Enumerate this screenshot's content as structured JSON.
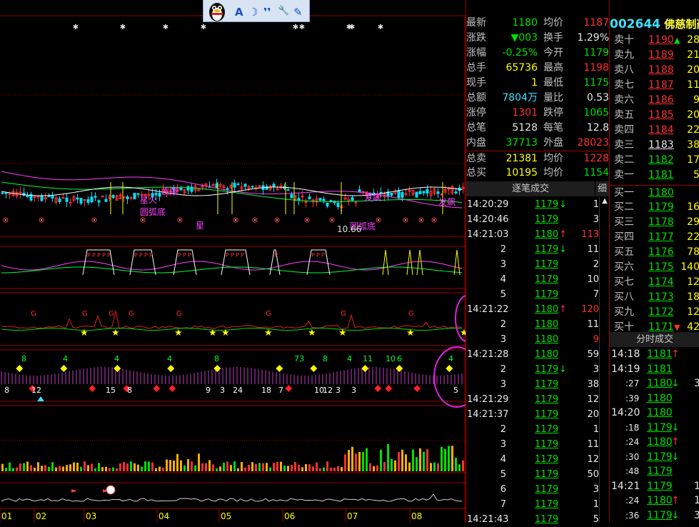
{
  "stock": {
    "code": "002644",
    "name": "佛慈制药"
  },
  "quote_rows": [
    {
      "l1": "最新",
      "v1": "1180",
      "c1": "green",
      "l2": "均价",
      "v2": "1187",
      "c2": "red"
    },
    {
      "l1": "涨跌",
      "v1": "▼003",
      "c1": "green",
      "l2": "换手",
      "v2": "1.29%",
      "c2": "white"
    },
    {
      "l1": "涨幅",
      "v1": "-0.25%",
      "c1": "green",
      "l2": "今开",
      "v2": "1179",
      "c2": "green"
    },
    {
      "l1": "总手",
      "v1": "65736",
      "c1": "yellow",
      "l2": "最高",
      "v2": "1198",
      "c2": "red"
    },
    {
      "l1": "现手",
      "v1": "1",
      "c1": "yellow",
      "l2": "最低",
      "v2": "1175",
      "c2": "green"
    },
    {
      "l1": "总额",
      "v1": "7804万",
      "c1": "cyan",
      "l2": "量比",
      "v2": "0.53",
      "c2": "white"
    },
    {
      "l1": "涨停",
      "v1": "1301",
      "c1": "red",
      "l2": "跌停",
      "v2": "1065",
      "c2": "green"
    },
    {
      "l1": "总笔",
      "v1": "5128",
      "c1": "white",
      "l2": "每笔",
      "v2": "12.8",
      "c2": "white"
    },
    {
      "l1": "内盘",
      "v1": "37713",
      "c1": "green",
      "l2": "外盘",
      "v2": "28023",
      "c2": "red"
    },
    {
      "l1": "总卖",
      "v1": "21381",
      "c1": "yellow",
      "l2": "均价",
      "v2": "1228",
      "c2": "red"
    },
    {
      "l1": "总买",
      "v1": "10195",
      "c1": "yellow",
      "l2": "均价",
      "v2": "1154",
      "c2": "green"
    }
  ],
  "tick_header": {
    "title": "逐笔成交",
    "detail": "细"
  },
  "ticks": [
    {
      "time": "14:20:29",
      "price": "1179",
      "arrow": "↓",
      "pc": "green",
      "vol": "1",
      "vc": "white"
    },
    {
      "time": "14:20:46",
      "price": "1179",
      "arrow": "",
      "pc": "green",
      "vol": "3",
      "vc": "white"
    },
    {
      "time": "14:21:03",
      "price": "1180",
      "arrow": "↑",
      "pc": "green",
      "vol": "113",
      "vc": "red"
    },
    {
      "time": "2",
      "price": "1179",
      "arrow": "↓",
      "pc": "green",
      "vol": "11",
      "vc": "white"
    },
    {
      "time": "3",
      "price": "1179",
      "arrow": "",
      "pc": "green",
      "vol": "2",
      "vc": "white"
    },
    {
      "time": "4",
      "price": "1179",
      "arrow": "",
      "pc": "green",
      "vol": "10",
      "vc": "white"
    },
    {
      "time": "5",
      "price": "1179",
      "arrow": "",
      "pc": "green",
      "vol": "7",
      "vc": "white"
    },
    {
      "time": "14:21:22",
      "price": "1180",
      "arrow": "↑",
      "pc": "green",
      "vol": "120",
      "vc": "red"
    },
    {
      "time": "2",
      "price": "1180",
      "arrow": "",
      "pc": "green",
      "vol": "11",
      "vc": "white"
    },
    {
      "time": "3",
      "price": "1180",
      "arrow": "",
      "pc": "green",
      "vol": "9",
      "vc": "red"
    },
    {
      "time": "14:21:28",
      "price": "1180",
      "arrow": "",
      "pc": "green",
      "vol": "59",
      "vc": "white"
    },
    {
      "time": "2",
      "price": "1179",
      "arrow": "↓",
      "pc": "green",
      "vol": "3",
      "vc": "white"
    },
    {
      "time": "3",
      "price": "1179",
      "arrow": "",
      "pc": "green",
      "vol": "38",
      "vc": "white"
    },
    {
      "time": "14:21:29",
      "price": "1179",
      "arrow": "",
      "pc": "green",
      "vol": "12",
      "vc": "white"
    },
    {
      "time": "14:21:37",
      "price": "1179",
      "arrow": "",
      "pc": "green",
      "vol": "20",
      "vc": "white"
    },
    {
      "time": "2",
      "price": "1179",
      "arrow": "",
      "pc": "green",
      "vol": "1",
      "vc": "white"
    },
    {
      "time": "3",
      "price": "1179",
      "arrow": "",
      "pc": "green",
      "vol": "11",
      "vc": "white"
    },
    {
      "time": "4",
      "price": "1179",
      "arrow": "",
      "pc": "green",
      "vol": "12",
      "vc": "white"
    },
    {
      "time": "5",
      "price": "1179",
      "arrow": "",
      "pc": "green",
      "vol": "50",
      "vc": "white"
    },
    {
      "time": "6",
      "price": "1179",
      "arrow": "",
      "pc": "green",
      "vol": "3",
      "vc": "white"
    },
    {
      "time": "7",
      "price": "1179",
      "arrow": "",
      "pc": "green",
      "vol": "1",
      "vc": "white"
    },
    {
      "time": "14:21:43",
      "price": "1179",
      "arrow": "",
      "pc": "green",
      "vol": "5",
      "vc": "white"
    }
  ],
  "sell_orders": [
    {
      "label": "卖十",
      "price": "1190",
      "mark": "▲",
      "vol": "28",
      "pc": "red"
    },
    {
      "label": "卖九",
      "price": "1189",
      "mark": "",
      "vol": "21",
      "pc": "red"
    },
    {
      "label": "卖八",
      "price": "1188",
      "mark": "",
      "vol": "20",
      "pc": "red"
    },
    {
      "label": "卖七",
      "price": "1187",
      "mark": "",
      "vol": "11",
      "pc": "red"
    },
    {
      "label": "卖六",
      "price": "1186",
      "mark": "",
      "vol": "9",
      "pc": "red"
    },
    {
      "label": "卖五",
      "price": "1185",
      "mark": "",
      "vol": "20",
      "pc": "red"
    },
    {
      "label": "卖四",
      "price": "1184",
      "mark": "",
      "vol": "22",
      "pc": "red"
    },
    {
      "label": "卖三",
      "price": "1183",
      "mark": "",
      "vol": "38",
      "pc": "white"
    },
    {
      "label": "卖二",
      "price": "1182",
      "mark": "",
      "vol": "17",
      "pc": "green"
    },
    {
      "label": "卖一",
      "price": "1181",
      "mark": "",
      "vol": "5",
      "pc": "green"
    }
  ],
  "buy_orders": [
    {
      "label": "买一",
      "price": "1180",
      "mark": "",
      "vol": "",
      "pc": "green"
    },
    {
      "label": "买二",
      "price": "1179",
      "mark": "",
      "vol": "16",
      "pc": "green"
    },
    {
      "label": "买三",
      "price": "1178",
      "mark": "",
      "vol": "29",
      "pc": "green"
    },
    {
      "label": "买四",
      "price": "1177",
      "mark": "",
      "vol": "22",
      "pc": "green"
    },
    {
      "label": "买五",
      "price": "1176",
      "mark": "",
      "vol": "78",
      "pc": "green"
    },
    {
      "label": "买六",
      "price": "1175",
      "mark": "",
      "vol": "140",
      "pc": "green"
    },
    {
      "label": "买七",
      "price": "1174",
      "mark": "",
      "vol": "12",
      "pc": "green"
    },
    {
      "label": "买八",
      "price": "1173",
      "mark": "",
      "vol": "18",
      "pc": "green"
    },
    {
      "label": "买九",
      "price": "1172",
      "mark": "",
      "vol": "12",
      "pc": "green"
    },
    {
      "label": "买十",
      "price": "1171",
      "mark": "▼",
      "vol": "42",
      "pc": "green"
    }
  ],
  "minute_header": "分时成交",
  "minute_ticks": [
    {
      "time": "14:18",
      "price": "1181",
      "arrow": "↑",
      "pc": "green",
      "vol": ""
    },
    {
      "time": "14:19",
      "price": "1181",
      "arrow": "",
      "pc": "green",
      "vol": ""
    },
    {
      "time": ":27",
      "price": "1180",
      "arrow": "↓",
      "pc": "green",
      "vol": "3"
    },
    {
      "time": ":39",
      "price": "1180",
      "arrow": "",
      "pc": "green",
      "vol": ""
    },
    {
      "time": "14:20",
      "price": "1180",
      "arrow": "",
      "pc": "green",
      "vol": ""
    },
    {
      "time": ":18",
      "price": "1179",
      "arrow": "↓",
      "pc": "green",
      "vol": ""
    },
    {
      "time": ":24",
      "price": "1180",
      "arrow": "↑",
      "pc": "green",
      "vol": ""
    },
    {
      "time": ":30",
      "price": "1179",
      "arrow": "↓",
      "pc": "green",
      "vol": ""
    },
    {
      "time": ":48",
      "price": "1179",
      "arrow": "",
      "pc": "green",
      "vol": ""
    },
    {
      "time": "14:21",
      "price": "1179",
      "arrow": "",
      "pc": "green",
      "vol": "14"
    },
    {
      "time": ":24",
      "price": "1180",
      "arrow": "↑",
      "pc": "green",
      "vol": "1"
    },
    {
      "time": ":36",
      "price": "1179",
      "arrow": "↓",
      "pc": "green",
      "vol": "3"
    }
  ],
  "chart": {
    "months": [
      "01",
      "02",
      "03",
      "04",
      "05",
      "06",
      "07",
      "08"
    ],
    "annotations": [
      {
        "text": "发飙",
        "color": "#ff40ff"
      },
      {
        "text": "发飙",
        "color": "#ff40ff"
      },
      {
        "text": "发飙",
        "color": "#ff40ff"
      },
      {
        "text": "圆弧底",
        "color": "#ff40ff"
      },
      {
        "text": "圆弧底",
        "color": "#ff40ff"
      },
      {
        "text": "星火",
        "color": "#ff40ff"
      },
      {
        "text": "星",
        "color": "#ff40ff"
      },
      {
        "text": "10.66",
        "color": "#e0e0e0"
      }
    ],
    "osc_labels": [
      "8",
      "4",
      "4",
      "4",
      "8",
      "73",
      "8",
      "4",
      "11",
      "10",
      "6",
      "4",
      "8",
      "12",
      "15",
      "8",
      "9",
      "3",
      "24",
      "18",
      "7",
      "10",
      "12",
      "3",
      "3",
      "5"
    ]
  },
  "qq_toolbar": {
    "items": [
      "A",
      "☽",
      "❜❜",
      "🔧",
      "✎"
    ]
  }
}
